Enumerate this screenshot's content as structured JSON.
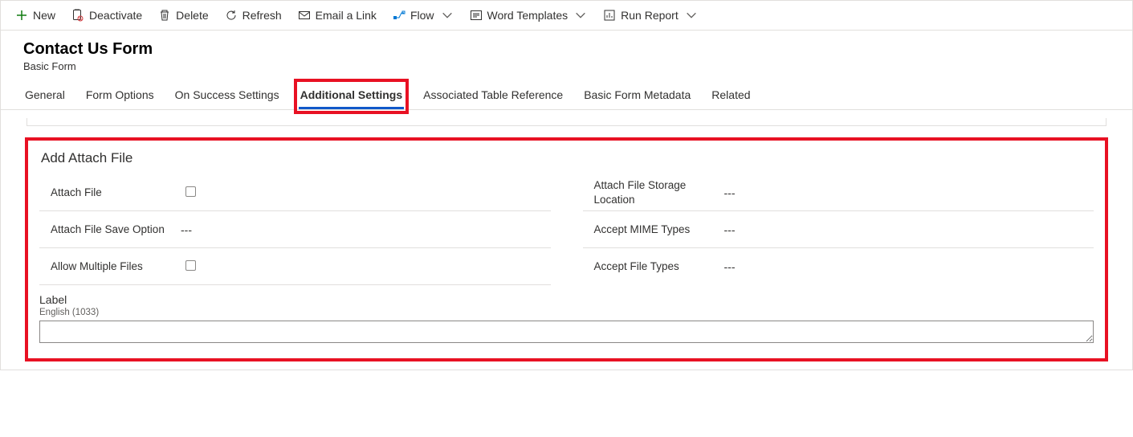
{
  "cmdbar": {
    "new": "New",
    "deactivate": "Deactivate",
    "delete": "Delete",
    "refresh": "Refresh",
    "email_link": "Email a Link",
    "flow": "Flow",
    "word_templates": "Word Templates",
    "run_report": "Run Report"
  },
  "header": {
    "title": "Contact Us Form",
    "subtitle": "Basic Form"
  },
  "tabs": {
    "general": "General",
    "form_options": "Form Options",
    "on_success": "On Success Settings",
    "additional": "Additional Settings",
    "assoc_table": "Associated Table Reference",
    "metadata": "Basic Form Metadata",
    "related": "Related"
  },
  "section": {
    "title": "Add Attach File",
    "left": {
      "attach_file": {
        "label": "Attach File"
      },
      "save_option": {
        "label": "Attach File Save Option",
        "value": "---"
      },
      "allow_multiple": {
        "label": "Allow Multiple Files"
      }
    },
    "right": {
      "storage_loc": {
        "label": "Attach File Storage Location",
        "value": "---"
      },
      "mime": {
        "label": "Accept MIME Types",
        "value": "---"
      },
      "file_types": {
        "label": "Accept File Types",
        "value": "---"
      }
    },
    "label_area": {
      "heading": "Label",
      "lang": "English (1033)",
      "value": ""
    }
  }
}
